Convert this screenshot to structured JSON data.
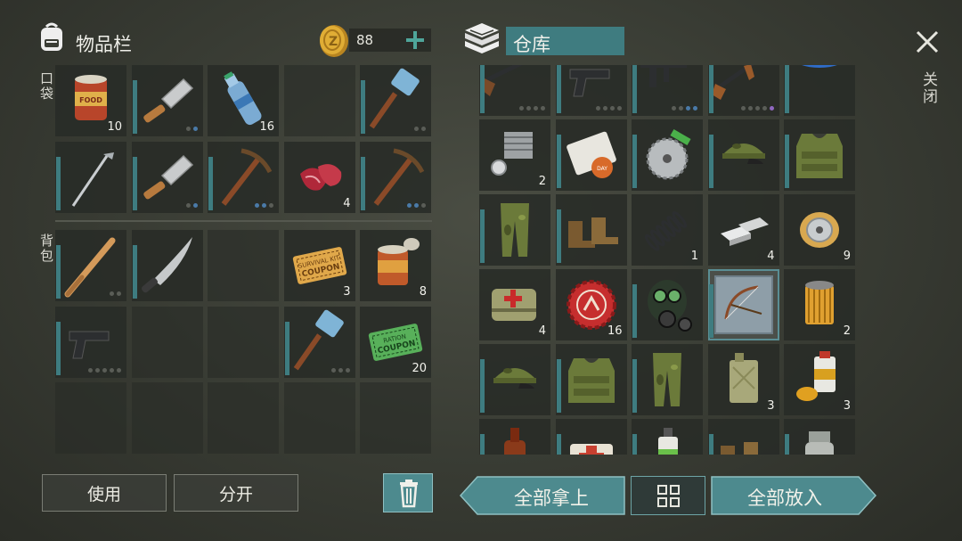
{
  "inventory": {
    "title": "物品栏",
    "pockets_label": "口袋",
    "backpack_label": "背包",
    "coins": "88",
    "pockets": [
      {
        "item": "canned-food",
        "count": "10"
      },
      {
        "item": "cleaver",
        "dots": [
          0,
          1
        ]
      },
      {
        "item": "water-bottle",
        "count": "16"
      },
      {
        "item": "empty"
      },
      {
        "item": "sledgehammer",
        "dots": [
          0,
          0
        ]
      },
      {
        "item": "golf-club"
      },
      {
        "item": "cleaver",
        "dots": [
          0,
          1
        ]
      },
      {
        "item": "pickaxe",
        "dots": [
          1,
          1,
          0
        ]
      },
      {
        "item": "raw-meat",
        "count": "4"
      },
      {
        "item": "pickaxe",
        "dots": [
          1,
          1,
          0
        ]
      }
    ],
    "backpack": [
      {
        "item": "baseball-bat",
        "dots": [
          0,
          0
        ]
      },
      {
        "item": "machete"
      },
      {
        "item": "empty"
      },
      {
        "item": "survival-coupon",
        "count": "3",
        "text": "SURVIVAL KIT COUPON"
      },
      {
        "item": "open-can",
        "count": "8"
      },
      {
        "item": "pistol",
        "dots": [
          0,
          0,
          0,
          0,
          0
        ]
      },
      {
        "item": "empty"
      },
      {
        "item": "empty"
      },
      {
        "item": "sledgehammer",
        "dots": [
          0,
          0,
          0
        ]
      },
      {
        "item": "ration-coupon",
        "count": "20",
        "text": "RATION COUPON"
      },
      {
        "item": "empty"
      },
      {
        "item": "empty"
      },
      {
        "item": "empty"
      },
      {
        "item": "empty"
      },
      {
        "item": "empty"
      }
    ],
    "use_label": "使用",
    "split_label": "分开"
  },
  "storage": {
    "title": "仓库",
    "close_label": "关闭",
    "items": [
      {
        "item": "shotgun",
        "dots": [
          0,
          0,
          0,
          0
        ]
      },
      {
        "item": "pistol",
        "dots": [
          0,
          0,
          0,
          0
        ]
      },
      {
        "item": "uzi",
        "dots": [
          0,
          0,
          1,
          1
        ]
      },
      {
        "item": "ak47",
        "dots": [
          0,
          0,
          0,
          0,
          2
        ]
      },
      {
        "item": "blue-pouch"
      },
      {
        "item": "engine-part",
        "count": "2"
      },
      {
        "item": "magazine"
      },
      {
        "item": "saw-blade"
      },
      {
        "item": "camo-cap"
      },
      {
        "item": "camo-vest"
      },
      {
        "item": "camo-pants"
      },
      {
        "item": "boots"
      },
      {
        "item": "spring",
        "count": "1"
      },
      {
        "item": "metal-bars",
        "count": "4"
      },
      {
        "item": "wire-spool",
        "count": "9"
      },
      {
        "item": "medkit-bag",
        "count": "4"
      },
      {
        "item": "bottle-cap",
        "count": "16"
      },
      {
        "item": "gas-mask"
      },
      {
        "item": "bow-recipe",
        "selected": true
      },
      {
        "item": "filter",
        "count": "2"
      },
      {
        "item": "camo-cap"
      },
      {
        "item": "camo-vest"
      },
      {
        "item": "camo-pants"
      },
      {
        "item": "jerrycan",
        "count": "3"
      },
      {
        "item": "paint-can",
        "count": "3"
      },
      {
        "item": "brown-bottle"
      },
      {
        "item": "bandage"
      },
      {
        "item": "spray-can"
      },
      {
        "item": "boots"
      },
      {
        "item": "glass-jar"
      }
    ],
    "take_all_label": "全部拿上",
    "put_all_label": "全部放入"
  },
  "colors": {
    "accent": "#4d8a8e",
    "durability": "#3e7c80",
    "coin": "#d9a62a"
  }
}
